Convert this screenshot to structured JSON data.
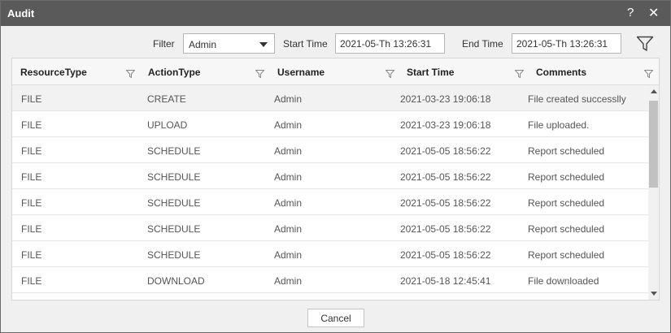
{
  "dialog": {
    "title": "Audit",
    "help_label": "?",
    "close_label": "✕"
  },
  "filter": {
    "filter_label": "Filter",
    "filter_value": "Admin",
    "start_label": "Start Time",
    "start_value": "2021-05-Th 13:26:31",
    "end_label": "End Time",
    "end_value": "2021-05-Th 13:26:31",
    "apply_icon": "funnel-icon"
  },
  "table": {
    "columns": [
      "ResourceType",
      "ActionType",
      "Username",
      "Start Time",
      "Comments"
    ],
    "rows": [
      [
        "FILE",
        "CREATE",
        "Admin",
        "2021-03-23 19:06:18",
        "File created successlly"
      ],
      [
        "FILE",
        "UPLOAD",
        "Admin",
        "2021-03-23 19:06:18",
        "File uploaded."
      ],
      [
        "FILE",
        "SCHEDULE",
        "Admin",
        "2021-05-05 18:56:22",
        "Report scheduled"
      ],
      [
        "FILE",
        "SCHEDULE",
        "Admin",
        "2021-05-05 18:56:22",
        "Report scheduled"
      ],
      [
        "FILE",
        "SCHEDULE",
        "Admin",
        "2021-05-05 18:56:22",
        "Report scheduled"
      ],
      [
        "FILE",
        "SCHEDULE",
        "Admin",
        "2021-05-05 18:56:22",
        "Report scheduled"
      ],
      [
        "FILE",
        "SCHEDULE",
        "Admin",
        "2021-05-05 18:56:22",
        "Report scheduled"
      ],
      [
        "FILE",
        "DOWNLOAD",
        "Admin",
        "2021-05-18 12:45:41",
        "File downloaded"
      ]
    ]
  },
  "footer": {
    "cancel_label": "Cancel"
  },
  "colors": {
    "titlebar": "#5a5a5a",
    "dialog_bg": "#f0f0f0",
    "selected_row": "#f2f2f2"
  }
}
